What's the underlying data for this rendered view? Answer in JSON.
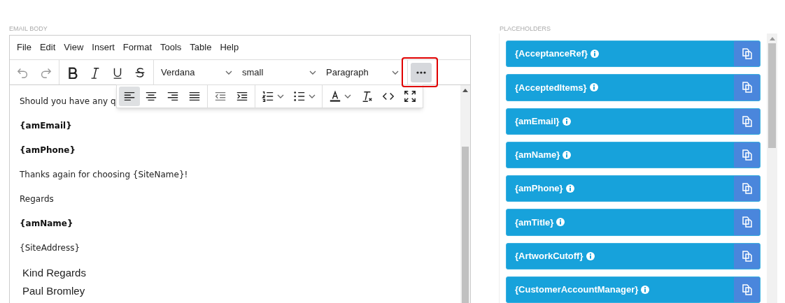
{
  "email_body": {
    "label": "EMAIL BODY",
    "menu": [
      "File",
      "Edit",
      "View",
      "Insert",
      "Format",
      "Tools",
      "Table",
      "Help"
    ],
    "toolbar_groups": [
      [
        {
          "kind": "undo",
          "disabled": true
        },
        {
          "kind": "redo",
          "disabled": true
        }
      ],
      [
        {
          "kind": "bold",
          "disabled": false
        },
        {
          "kind": "italic",
          "disabled": false
        },
        {
          "kind": "underline",
          "disabled": false
        },
        {
          "kind": "strike",
          "disabled": false
        }
      ]
    ],
    "dropdowns": [
      {
        "value": "Verdana"
      },
      {
        "value": "small"
      },
      {
        "value": "Paragraph"
      }
    ],
    "more_button": {
      "highlighted": true
    },
    "floating_toolbar": [
      [
        {
          "kind": "align-left",
          "selected": true
        },
        {
          "kind": "align-center",
          "selected": false
        },
        {
          "kind": "align-right",
          "selected": false
        },
        {
          "kind": "justify",
          "selected": false
        }
      ],
      [
        {
          "kind": "outdent",
          "selected": false
        },
        {
          "kind": "indent",
          "selected": false
        }
      ],
      [
        {
          "kind": "numbered-list",
          "selected": false
        },
        {
          "kind": "bullet-list",
          "selected": false
        }
      ],
      [
        {
          "kind": "text-color",
          "selected": false
        },
        {
          "kind": "clear-format",
          "selected": false
        },
        {
          "kind": "code",
          "selected": false
        },
        {
          "kind": "fullscreen",
          "selected": false
        }
      ]
    ],
    "paragraphs": [
      {
        "kind": "plain",
        "text": "Should you have any q"
      },
      {
        "kind": "bold",
        "text": "{amEmail}"
      },
      {
        "kind": "bold",
        "text": "{amPhone}"
      },
      {
        "kind": "plain",
        "text": "Thanks again for choosing {SiteName}!"
      },
      {
        "kind": "plain",
        "text": "Regards"
      },
      {
        "kind": "bold",
        "text": "{amName}"
      },
      {
        "kind": "plain",
        "text": "{SiteAddress}"
      },
      {
        "kind": "signature",
        "text": "Kind Regards"
      },
      {
        "kind": "signature",
        "text": "Paul Bromley"
      }
    ]
  },
  "placeholders": {
    "label": "PLACEHOLDERS",
    "items": [
      "{AcceptanceRef}",
      "{AcceptedItems}",
      "{amEmail}",
      "{amName}",
      "{amPhone}",
      "{amTitle}",
      "{ArtworkCutoff}",
      "{CustomerAccountManager}"
    ]
  }
}
